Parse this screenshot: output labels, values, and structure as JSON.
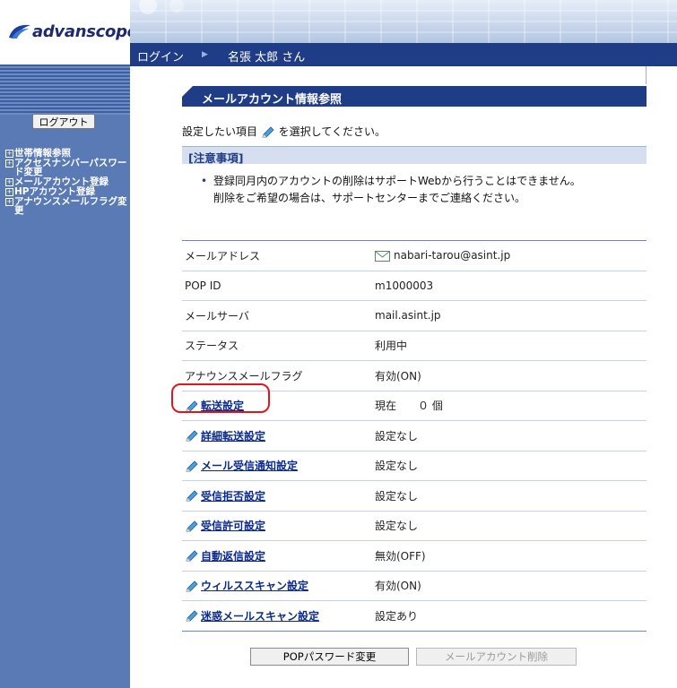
{
  "brand": {
    "name": "advanscope"
  },
  "header": {
    "login_label": "ログイン",
    "separator": "▶",
    "user_name": "名張 太郎 さん"
  },
  "sidebar": {
    "logout_label": "ログアウト",
    "menu": [
      {
        "label": "世帯情報参照"
      },
      {
        "label": "アクセスナンバーパスワード変更"
      },
      {
        "label": "メールアカウント登録"
      },
      {
        "label": "HPアカウント登録"
      },
      {
        "label": "アナウンスメールフラグ変更"
      }
    ]
  },
  "page": {
    "title": "メールアカウント情報参照",
    "instruction_before": "設定したい項目",
    "instruction_after": "を選択してください。",
    "notice_title": "[注意事項]",
    "notice_line1": "登録同月内のアカウントの削除はサポートWebから行うことはできません。",
    "notice_line2": "削除をご希望の場合は、サポートセンターまでご連絡ください。"
  },
  "table": {
    "rows": [
      {
        "label": "メールアドレス",
        "value": "nabari-tarou@asint.jp",
        "link": false,
        "icon": "mail-icon"
      },
      {
        "label": "POP ID",
        "value": "m1000003",
        "link": false
      },
      {
        "label": "メールサーバ",
        "value": "mail.asint.jp",
        "link": false
      },
      {
        "label": "ステータス",
        "value": "利用中",
        "link": false
      },
      {
        "label": "アナウンスメールフラグ",
        "value": "有効(ON)",
        "link": false
      },
      {
        "label": "転送設定",
        "value": "現在　　０ 個",
        "link": true
      },
      {
        "label": "詳細転送設定",
        "value": "設定なし",
        "link": true
      },
      {
        "label": "メール受信通知設定",
        "value": "設定なし",
        "link": true
      },
      {
        "label": "受信拒否設定",
        "value": "設定なし",
        "link": true
      },
      {
        "label": "受信許可設定",
        "value": "設定なし",
        "link": true
      },
      {
        "label": "自動返信設定",
        "value": "無効(OFF)",
        "link": true
      },
      {
        "label": "ウィルススキャン設定",
        "value": "有効(ON)",
        "link": true
      },
      {
        "label": "迷惑メールスキャン設定",
        "value": "設定あり",
        "link": true
      }
    ]
  },
  "buttons": {
    "pop_password_change": "POPパスワード変更",
    "mail_account_delete": "メールアカウント削除"
  },
  "colors": {
    "navy": "#1f3c86",
    "sidebar": "#5a7ab6",
    "highlight": "#e0161f",
    "link": "#0b2a8c"
  }
}
